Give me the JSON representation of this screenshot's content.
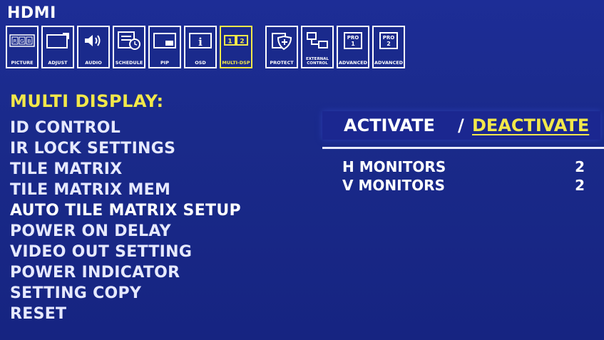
{
  "header": {
    "source": "HDMI"
  },
  "icons": [
    {
      "id": "picture",
      "label": "PICTURE",
      "glyph": "R G B"
    },
    {
      "id": "adjust",
      "label": "ADJUST"
    },
    {
      "id": "audio",
      "label": "AUDIO"
    },
    {
      "id": "schedule",
      "label": "SCHEDULE"
    },
    {
      "id": "pip",
      "label": "PIP"
    },
    {
      "id": "osd",
      "label": "OSD",
      "glyph": "i"
    },
    {
      "id": "multi-display",
      "label": "MULTI-DSP",
      "glyph": "1 2",
      "active": true
    },
    {
      "id": "protect",
      "label": "PROTECT"
    },
    {
      "id": "external-control",
      "label": "EXTERNAL CONTROL"
    },
    {
      "id": "advanced-1",
      "label": "ADVANCED",
      "glyph": "PRO 1"
    },
    {
      "id": "advanced-2",
      "label": "ADVANCED",
      "glyph": "PRO 2"
    }
  ],
  "menu": {
    "heading": "MULTI DISPLAY:",
    "items": [
      "ID CONTROL",
      "IR LOCK SETTINGS",
      "TILE MATRIX",
      "TILE MATRIX MEM",
      "AUTO TILE MATRIX SETUP",
      "POWER ON DELAY",
      "VIDEO OUT SETTING",
      "POWER INDICATOR",
      "SETTING COPY",
      "RESET"
    ],
    "selected_index": 4
  },
  "settings": {
    "activate_label": "ACTIVATE",
    "separator": "/",
    "deactivate_label": "DEACTIVATE",
    "h_monitors_label": "H MONITORS",
    "h_monitors_value": "2",
    "v_monitors_label": "V MONITORS",
    "v_monitors_value": "2"
  },
  "colors": {
    "background": "#1a2a8c",
    "highlight": "#f2e84a",
    "text": "#ffffff"
  }
}
